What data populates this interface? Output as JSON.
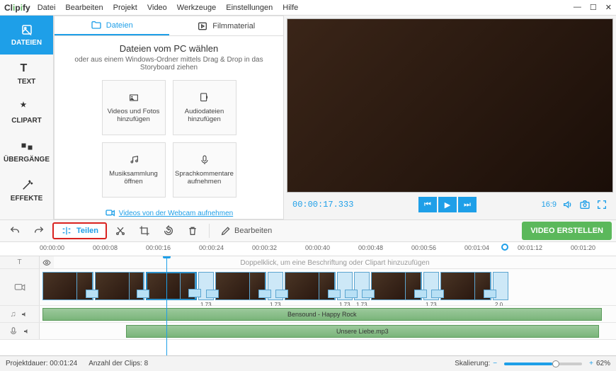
{
  "app": {
    "name": "Clipify"
  },
  "menu": [
    "Datei",
    "Bearbeiten",
    "Projekt",
    "Video",
    "Werkzeuge",
    "Einstellungen",
    "Hilfe"
  ],
  "sidebar": [
    {
      "label": "DATEIEN",
      "icon": "files"
    },
    {
      "label": "TEXT",
      "icon": "text"
    },
    {
      "label": "CLIPART",
      "icon": "star"
    },
    {
      "label": "ÜBERGÄNGE",
      "icon": "transition"
    },
    {
      "label": "EFFEKTE",
      "icon": "wand"
    }
  ],
  "mediapanel": {
    "tabs": {
      "files": "Dateien",
      "stock": "Filmmaterial"
    },
    "title": "Dateien vom PC wählen",
    "subtitle": "oder aus einem Windows-Ordner mittels Drag & Drop in das Storyboard ziehen",
    "tiles": [
      {
        "label": "Videos und Fotos hinzufügen",
        "icon": "film"
      },
      {
        "label": "Audiodateien hinzufügen",
        "icon": "audio"
      },
      {
        "label": "Musiksammlung öffnen",
        "icon": "music"
      },
      {
        "label": "Sprachkommentare aufnehmen",
        "icon": "mic"
      }
    ],
    "webcam": "Videos von der Webcam aufnehmen"
  },
  "preview": {
    "timecode": "00:00:17.333",
    "aspect": "16:9"
  },
  "toolbar": {
    "split": "Teilen",
    "edit": "Bearbeiten",
    "create": "VIDEO ERSTELLEN"
  },
  "ruler": [
    "00:00:00",
    "00:00:08",
    "00:00:16",
    "00:00:24",
    "00:00:32",
    "00:00:40",
    "00:00:48",
    "00:00:56",
    "00:01:04",
    "00:01:12",
    "00:01:20"
  ],
  "timeline": {
    "caption_hint": "Doppelklick, um eine Beschriftung oder Clipart hinzuzufügen",
    "image_dur": "1.73",
    "image_dur_last": "2.0",
    "audio1": "Bensound - Happy Rock",
    "audio2": "Unsere Liebe.mp3"
  },
  "status": {
    "duration_label": "Projektdauer:",
    "duration": "00:01:24",
    "clips_label": "Anzahl der Clips:",
    "clips": "8",
    "scale_label": "Skalierung:",
    "scale_value": "62%"
  }
}
